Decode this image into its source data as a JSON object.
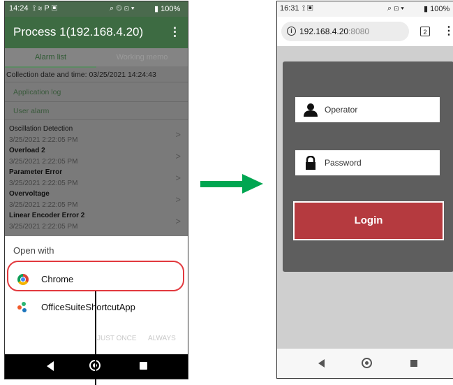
{
  "left_phone": {
    "status": {
      "time": "14:24",
      "icons": "⟟ ≋ P ▣",
      "right_icons": "⌕ ⏲ ⊡ ▾",
      "battery": "▮ 100%"
    },
    "app_title": "Process 1(192.168.4.20)",
    "menu_icon": "⋮",
    "tabs": [
      {
        "label": "Alarm list",
        "active": true
      },
      {
        "label": "Working memo",
        "active": false
      }
    ],
    "collection_label": "Collection date and time: 03/25/2021 14:24:43",
    "sections": {
      "application_log": "Application log",
      "user_alarm": "User alarm"
    },
    "alarms": [
      {
        "name": "Oscillation Detection",
        "time": "3/25/2021 2:22:05 PM",
        "bold": false
      },
      {
        "name": "Overload 2",
        "time": "3/25/2021 2:22:05 PM",
        "bold": true
      },
      {
        "name": "Parameter Error",
        "time": "3/25/2021 2:22:05 PM",
        "bold": true
      },
      {
        "name": "Overvoltage",
        "time": "3/25/2021 2:22:05 PM",
        "bold": true
      },
      {
        "name": "Linear Encoder Error 2",
        "time": "3/25/2021 2:22:05 PM",
        "bold": true
      }
    ],
    "open_with": {
      "title": "Open with",
      "options": [
        {
          "label": "Chrome",
          "icon": "chrome-icon",
          "highlighted": true
        },
        {
          "label": "OfficeSuiteShortcutApp",
          "icon": "officesuite-icon",
          "highlighted": false
        }
      ],
      "just_once": "JUST ONCE",
      "always": "ALWAYS"
    },
    "highlight_color": "#e2393e"
  },
  "arrow_color": "#00a651",
  "right_phone": {
    "status": {
      "time": "16:31",
      "icons": "⟟ ▣",
      "right_icons": "⌕ ⊡ ▾",
      "battery": "▮ 100%"
    },
    "url_host": "192.168.4.20",
    "url_port": ":8080",
    "tab_count": "2",
    "menu_icon": "⋮",
    "operator_placeholder": "Operator",
    "password_placeholder": "Password",
    "login_label": "Login",
    "login_color": "#b53a3f"
  }
}
